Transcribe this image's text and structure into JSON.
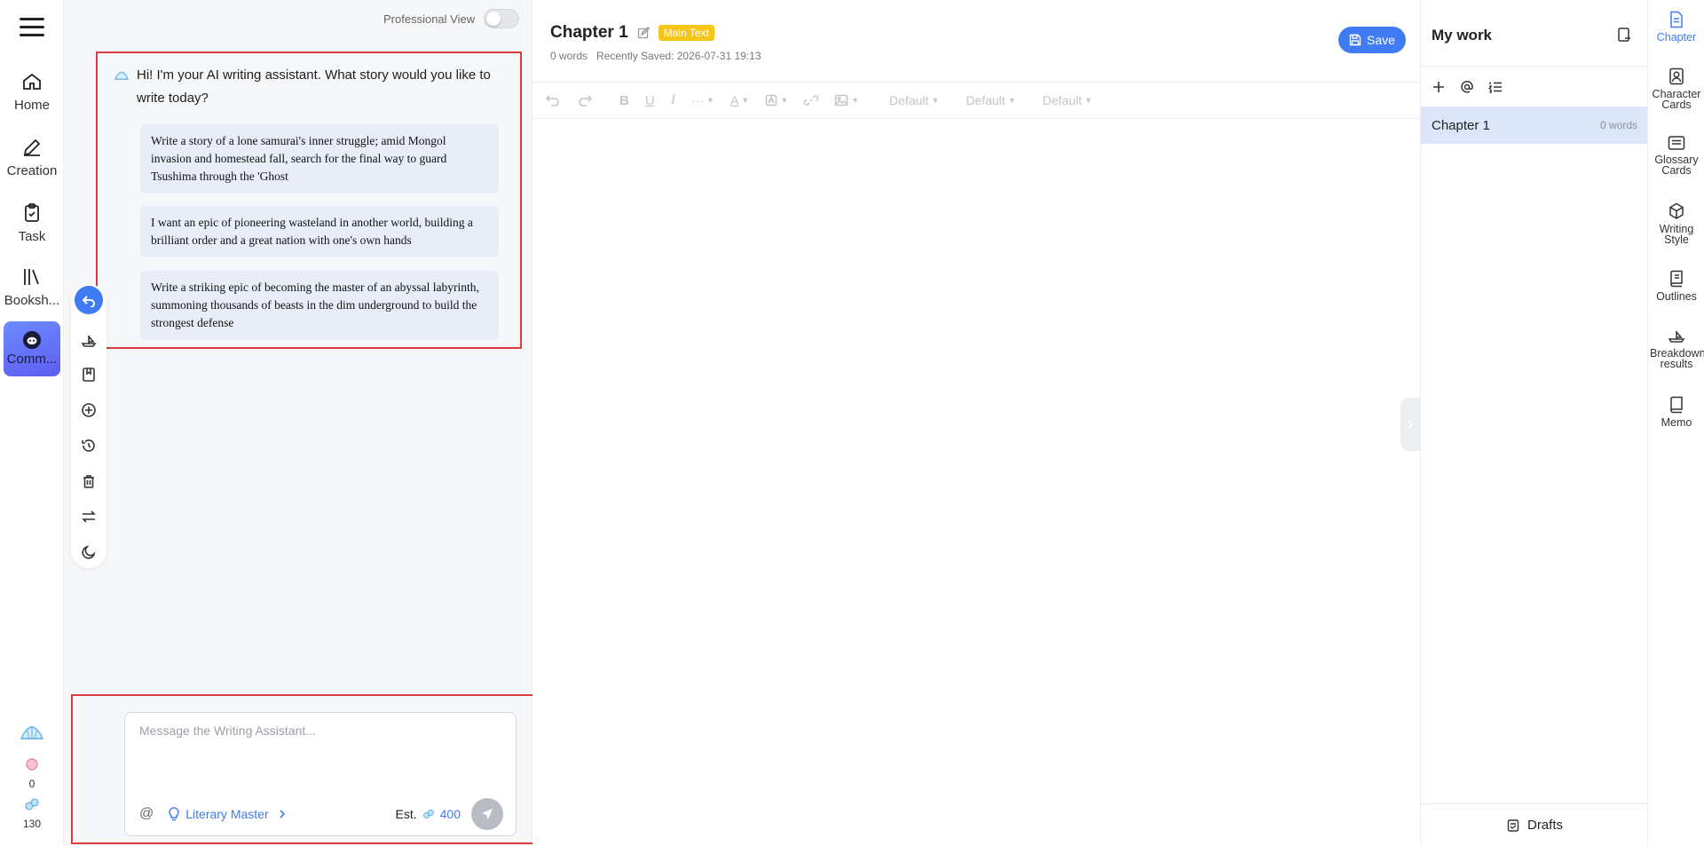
{
  "nav": {
    "items": [
      {
        "label": "Home",
        "icon": "home-icon"
      },
      {
        "label": "Creation",
        "icon": "pen-icon"
      },
      {
        "label": "Task",
        "icon": "clipboard-icon"
      },
      {
        "label": "Booksh...",
        "icon": "books-icon"
      },
      {
        "label": "Comm...",
        "icon": "discord-icon"
      }
    ],
    "bottom": {
      "coin_a": "0",
      "coin_b": "130"
    }
  },
  "assistant": {
    "pro_view_label": "Professional View",
    "greeting": "Hi! I'm your AI writing assistant. What story would you like to write today?",
    "suggestions": [
      "Write a story of a lone samurai's inner struggle; amid Mongol invasion and homestead fall, search for the final way to guard Tsushima through the 'Ghost",
      "I want an epic of pioneering wasteland in another world, building a brilliant order and a great nation with one's own hands",
      "Write a striking epic of becoming the master of an abyssal labyrinth, summoning thousands of beasts in the dim underground to build the strongest defense"
    ],
    "input_placeholder": "Message the Writing Assistant...",
    "at_symbol": "@",
    "mode_label": "Literary Master",
    "est_label": "Est.",
    "est_value": "400"
  },
  "editor": {
    "title": "Chapter 1",
    "badge": "Main Text",
    "word_count": "0 words",
    "saved": "Recently Saved: 2026-07-31 19:13",
    "save_label": "Save",
    "toolbar_dropdowns": [
      "Default",
      "Default",
      "Default"
    ],
    "more_glyph": "···",
    "font_color_glyph": "A"
  },
  "mywork": {
    "title": "My work",
    "chapter_name": "Chapter 1",
    "chapter_words": "0 words",
    "drafts_label": "Drafts"
  },
  "rightrail": {
    "items": [
      "Chapter",
      "Character Cards",
      "Glossary Cards",
      "Writing Style",
      "Outlines",
      "Breakdown results",
      "Memo"
    ]
  },
  "colors": {
    "accent": "#3f7cf4",
    "badge": "#f5c518",
    "highlight_border": "#dc3c3c"
  }
}
